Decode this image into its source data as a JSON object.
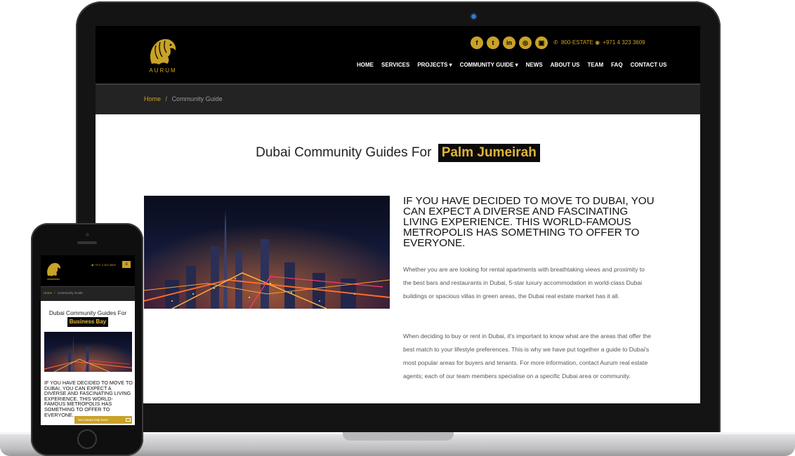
{
  "site": {
    "logo_text": "AURUM",
    "social_icons": [
      {
        "icon": "facebook-icon",
        "glyph": "f"
      },
      {
        "icon": "twitter-icon",
        "glyph": "t"
      },
      {
        "icon": "linkedin-icon",
        "glyph": "in"
      },
      {
        "icon": "instagram-icon",
        "glyph": "◎"
      },
      {
        "icon": "youtube-icon",
        "glyph": "▣"
      }
    ],
    "phone_label": "800-ESTATE",
    "phone_number": "+971 4 323 3609",
    "nav": [
      "HOME",
      "SERVICES",
      "PROJECTS ▾",
      "COMMUNITY GUIDE ▾",
      "NEWS",
      "ABOUT US",
      "TEAM",
      "FAQ",
      "CONTACT US"
    ],
    "breadcrumb_home": "Home",
    "breadcrumb_sep": "/",
    "breadcrumb_current": "Community Guide",
    "colors": {
      "gold": "#c9a227",
      "black": "#000000",
      "dark_bar": "#232323"
    }
  },
  "desktop": {
    "headline_prefix": "Dubai Community Guides For",
    "headline_highlight": "Palm Jumeirah",
    "article_heading": "IF YOU HAVE DECIDED TO MOVE TO DUBAI, YOU CAN EXPECT A DIVERSE AND FASCINATING LIVING EXPERIENCE. THIS WORLD-FAMOUS METROPOLIS HAS SOMETHING TO OFFER TO EVERYONE.",
    "paragraph_1": "Whether you are are looking for rental apartments with breathtaking views and proximity to the best bars and restaurants in Dubai, 5-star luxury accommodation in world-class Dubai buildings or spacious villas in green areas, the Dubai real estate market has it all.",
    "paragraph_2": "When deciding to buy or rent in Dubai, it's important to know what are the areas that offer the best match to your lifestyle preferences. This is why we have put together a guide to Dubai's most popular areas for buyers and tenants. For more information, contact Aurum real estate agents; each of our team members specialise on a specific Dubai area or community."
  },
  "mobile": {
    "phone_number": "+971 4 323 3609",
    "menu_icon": "hamburger-icon",
    "headline_prefix": "Dubai Community Guides For",
    "headline_highlight": "Business Bay",
    "article_heading": "IF YOU HAVE DECIDED TO MOVE TO DUBAI, YOU CAN EXPECT A DIVERSE AND FASCINATING LIVING EXPERIENCE. THIS WORLD-FAMOUS METROPOLIS HAS SOMETHING TO OFFER TO EVERYONE.",
    "help_button": "Get instant help here!"
  }
}
